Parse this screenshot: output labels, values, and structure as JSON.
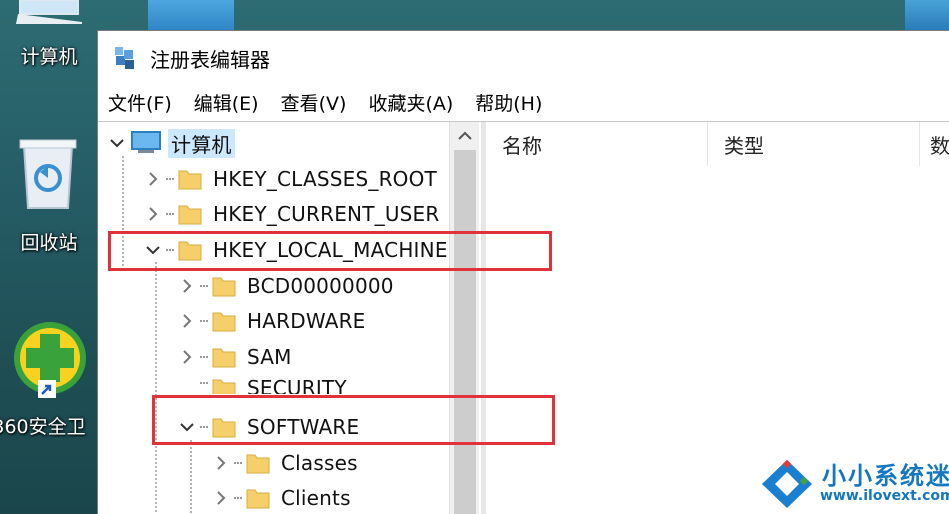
{
  "desktop": {
    "icons": [
      {
        "label": "计算机"
      },
      {
        "label": "回收站"
      },
      {
        "label": "360安全卫"
      }
    ]
  },
  "window": {
    "title": "注册表编辑器",
    "menu": [
      "文件(F)",
      "编辑(E)",
      "查看(V)",
      "收藏夹(A)",
      "帮助(H)"
    ]
  },
  "tree": {
    "root": "计算机",
    "items": [
      {
        "label": "HKEY_CLASSES_ROOT"
      },
      {
        "label": "HKEY_CURRENT_USER"
      },
      {
        "label": "HKEY_LOCAL_MACHINE"
      },
      {
        "label": "BCD00000000"
      },
      {
        "label": "HARDWARE"
      },
      {
        "label": "SAM"
      },
      {
        "label": "SECURITY"
      },
      {
        "label": "SOFTWARE"
      },
      {
        "label": "Classes"
      },
      {
        "label": "Clients"
      }
    ]
  },
  "list": {
    "columns": [
      "名称",
      "类型",
      "数"
    ]
  },
  "watermark": {
    "name": "小小系统迷",
    "url": "www.ilovext.com"
  },
  "colors": {
    "highlight": "#e0323a",
    "folder": "#f4cf6a",
    "selection": "#cce8ff",
    "watermark": "#1577c0"
  }
}
